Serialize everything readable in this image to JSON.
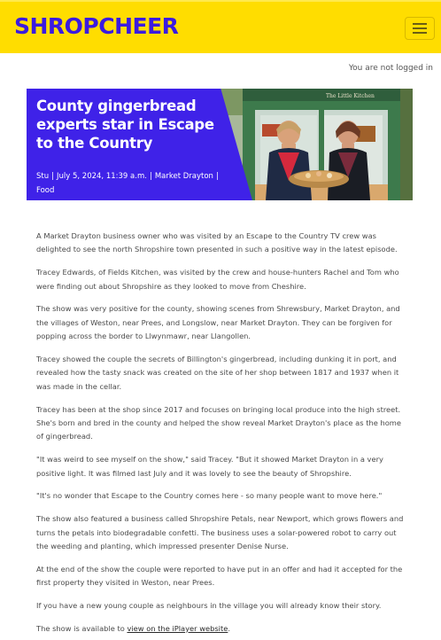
{
  "header": {
    "logo": "SHROPCHEER",
    "colors": {
      "background": "#ffdd00",
      "logo": "#3b1be0"
    },
    "menu_icon": "hamburger-icon"
  },
  "session": {
    "login_status": "You are not logged in"
  },
  "hero": {
    "title": "County gingerbread experts star in  Escape to the Country",
    "author": "Stu",
    "date": "July 5, 2024, 11:39 a.m.",
    "location": "Market  Drayton",
    "category": "Food",
    "photo_sign": "The Little Kitchen",
    "title_box_color": "#3f22e8"
  },
  "article": {
    "paragraphs": [
      "A  Market  Drayton business owner who was visited by an  Escape to the Country TV crew was delighted to see the north Shropshire town presented in such a positive way in the latest episode.",
      "Tracey  Edwards, of  Fields  Kitchen, was visited by the crew and house-hunters  Rachel and Tom who were finding out about Shropshire as they looked to move from Cheshire.",
      "The show was very positive for the county, showing scenes from Shrewsbury,  Market  Drayton, and the villages of Weston, near  Prees, and  Longslow, near  Market  Drayton. They can be forgiven for popping across the border to  Llwynmawr, near  Llangollen.",
      "Tracey showed the couple the secrets of  Billington's gingerbread, including dunking it in port, and revealed how the tasty snack was created on the site of her shop between 1817 and 1937 when it was made in the cellar.",
      "Tracey has been at the shop since 2017 and focuses on bringing local produce into the high street. She's born and bred in the county and helped the show reveal  Market Drayton's place as the home of gingerbread.",
      "\"It was weird to see myself on the show,\" said Tracey. \"But it showed  Market  Drayton in a very positive light.  It was filmed last July and it was lovely to see the beauty of Shropshire.",
      "\"It's no wonder that  Escape to the Country comes here - so many people want to move here.\"",
      "The show also featured a business called Shropshire  Petals, near  Newport, which grows flowers and turns the petals into biodegradable confetti.  The business uses a solar-powered robot to carry out the weeding and planting, which impressed presenter  Denise  Nurse.",
      "At the end of the show the couple were reported to have put in an offer and had it accepted for the first property they visited in Weston, near  Prees.",
      "If you have a new young couple as neighbours in the village you will already know their story."
    ],
    "closing_prefix": "The show is available to ",
    "closing_link": "view on the iPlayer website",
    "closing_suffix": "."
  }
}
